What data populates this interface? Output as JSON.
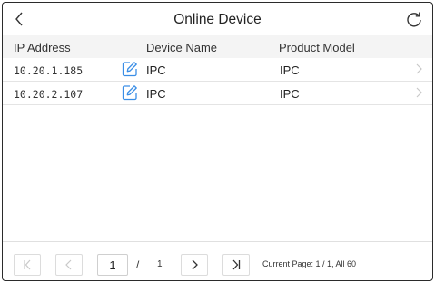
{
  "header": {
    "title": "Online Device"
  },
  "table": {
    "columns": [
      "IP Address",
      "Device Name",
      "Product Model"
    ],
    "rows": [
      {
        "ip": "10.20.1.185",
        "name": "IPC",
        "model": "IPC"
      },
      {
        "ip": "10.20.2.107",
        "name": "IPC",
        "model": "IPC"
      }
    ]
  },
  "pagination": {
    "current_page": "1",
    "separator": "/",
    "total_pages": "1",
    "info": "Current Page: 1 / 1, All 60"
  },
  "icons": {
    "back": "chevron-left-icon",
    "refresh": "refresh-icon",
    "edit": "edit-pencil-icon",
    "row_arrow": "chevron-right-icon",
    "first": "first-page-icon",
    "prev": "prev-page-icon",
    "next": "next-page-icon",
    "last": "last-page-icon"
  },
  "colors": {
    "accent": "#3a8ee6",
    "border": "#2b2b2b",
    "header_bg": "#f4f4f4"
  }
}
